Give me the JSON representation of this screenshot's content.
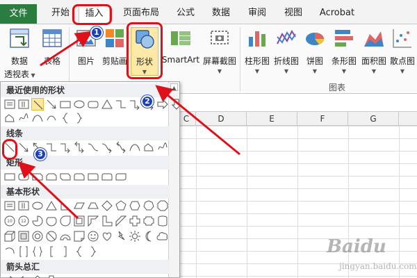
{
  "tabs": [
    {
      "label": "文件"
    },
    {
      "label": "开始"
    },
    {
      "label": "插入"
    },
    {
      "label": "页面布局"
    },
    {
      "label": "公式"
    },
    {
      "label": "数据"
    },
    {
      "label": "审阅"
    },
    {
      "label": "视图"
    },
    {
      "label": "Acrobat"
    }
  ],
  "ribbon": {
    "pivot_line1": "数据",
    "pivot_line2": "透视表",
    "table": "表格",
    "picture": "图片",
    "clipart": "剪贴画",
    "shapes": "形状",
    "smartart": "SmartArt",
    "screenshot": "屏幕截图",
    "charts": [
      {
        "label": "柱形图"
      },
      {
        "label": "折线图"
      },
      {
        "label": "饼图"
      },
      {
        "label": "条形图"
      },
      {
        "label": "面积图"
      },
      {
        "label": "散点图"
      }
    ],
    "chart_group": "图表"
  },
  "columns": [
    "C",
    "D",
    "E",
    "F",
    "G"
  ],
  "shapes_panel": {
    "sections": [
      {
        "title": "最近使用的形状"
      },
      {
        "title": "线条"
      },
      {
        "title": "矩形"
      },
      {
        "title": "基本形状"
      },
      {
        "title": "箭头总汇"
      }
    ]
  },
  "badges": [
    "1",
    "2",
    "3"
  ],
  "watermark": {
    "brand": "Baidu",
    "sub": "jingyan.baidu.com"
  },
  "colors": {
    "file_tab": "#2a7c3f",
    "annotation_red": "#e0101a",
    "badge_blue": "#1c3fbf",
    "selected_shape": "#fce79a"
  }
}
